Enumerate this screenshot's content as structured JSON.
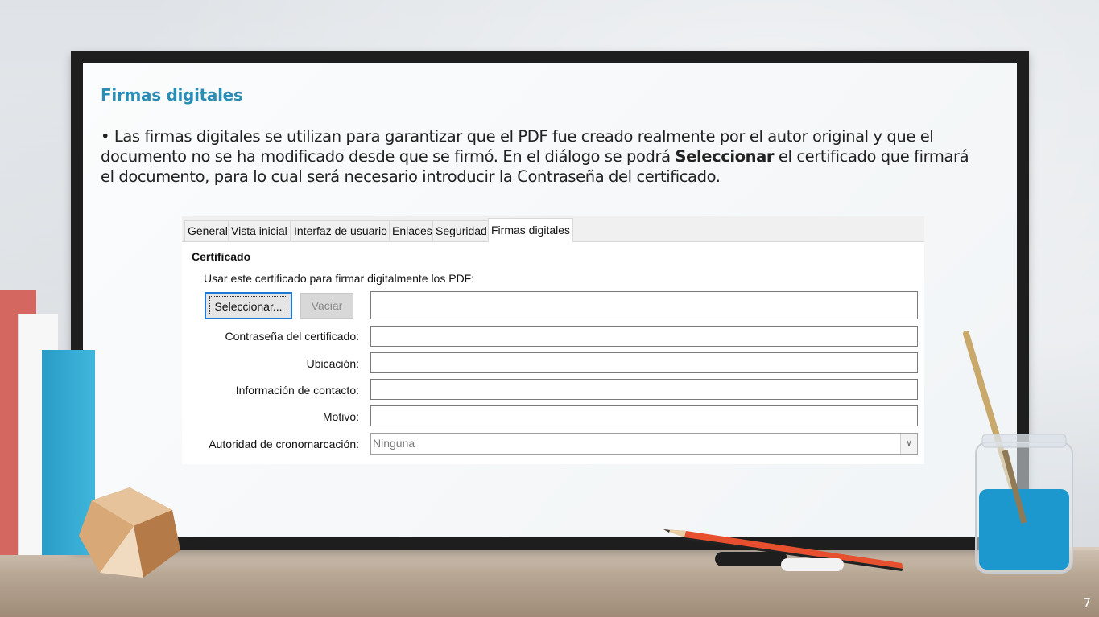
{
  "slide": {
    "title": "Firmas digitales",
    "paragraph_part1": "• Las firmas digitales se utilizan para garantizar que el PDF fue creado realmente por el autor original y que el documento no se ha modificado desde que se firmó. En el diálogo se podrá ",
    "paragraph_bold": "Seleccionar",
    "paragraph_part2": " el certificado que firmará el documento, para lo cual será necesario introducir la Contraseña del certificado.",
    "page_number": "7"
  },
  "dialog": {
    "tabs": [
      {
        "label": "General"
      },
      {
        "label": "Vista inicial"
      },
      {
        "label": "Interfaz de usuario"
      },
      {
        "label": "Enlaces"
      },
      {
        "label": "Seguridad"
      },
      {
        "label": "Firmas digitales",
        "active": true
      }
    ],
    "section_title": "Certificado",
    "use_cert_label": "Usar este certificado para firmar digitalmente los PDF:",
    "select_button": "Seleccionar...",
    "clear_button": "Vaciar",
    "password_label": "Contraseña del certificado:",
    "location_label": "Ubicación:",
    "contact_label": "Información de contacto:",
    "reason_label": "Motivo:",
    "tsa_label": "Autoridad de cronomarcación:",
    "tsa_value": "Ninguna"
  },
  "colors": {
    "title": "#2a8db5",
    "focus_border": "#1f78d1"
  }
}
